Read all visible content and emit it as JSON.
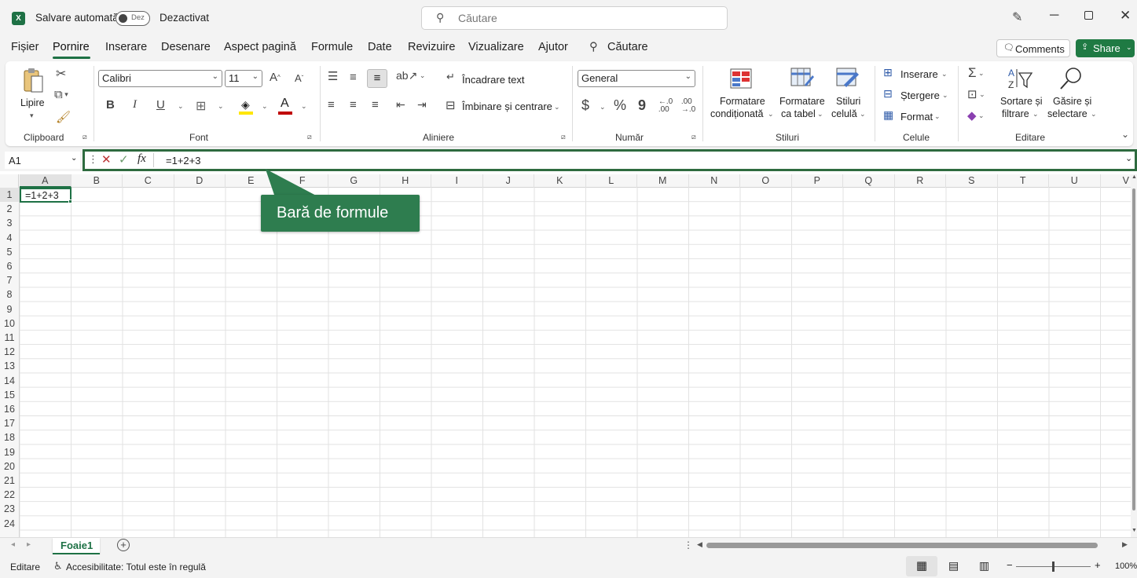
{
  "title_bar": {
    "autosave_label": "Salvare automată",
    "toggle_state": "Dez",
    "autosave_status": "Dezactivat",
    "search_placeholder": "Căutare"
  },
  "menu": {
    "items": [
      "Fișier",
      "Pornire",
      "Inserare",
      "Desenare",
      "Aspect pagină",
      "Formule",
      "Date",
      "Revizuire",
      "Vizualizare",
      "Ajutor"
    ],
    "active": "Pornire",
    "search_label": "Căutare",
    "comments_label": "Comments",
    "share_label": "Share"
  },
  "ribbon": {
    "clipboard": {
      "paste_label": "Lipire",
      "group_label": "Clipboard"
    },
    "font": {
      "font_name": "Calibri",
      "font_size": "11",
      "bold": "B",
      "italic": "I",
      "underline": "U",
      "group_label": "Font"
    },
    "alignment": {
      "wrap_text": "Încadrare text",
      "merge_center": "Îmbinare și centrare",
      "group_label": "Aliniere"
    },
    "number": {
      "format": "General",
      "currency": "$",
      "percent": "%",
      "comma": "9",
      "inc_decimal": "←.0\n.00",
      "dec_decimal": ".00\n→.0",
      "group_label": "Număr"
    },
    "styles": {
      "conditional_l1": "Formatare",
      "conditional_l2": "condiționată",
      "table_l1": "Formatare",
      "table_l2": "ca tabel",
      "cell_l1": "Stiluri",
      "cell_l2": "celulă",
      "group_label": "Stiluri"
    },
    "cells": {
      "insert": "Inserare",
      "delete": "Ștergere",
      "format": "Format",
      "group_label": "Celule"
    },
    "editing": {
      "sort_l1": "Sortare și",
      "sort_l2": "filtrare",
      "find_l1": "Găsire și",
      "find_l2": "selectare",
      "group_label": "Editare"
    }
  },
  "formula_bar": {
    "name_box": "A1",
    "fx": "fx",
    "formula": "=1+2+3"
  },
  "callout": {
    "text": "Bară de formule"
  },
  "columns": [
    "A",
    "B",
    "C",
    "D",
    "E",
    "F",
    "G",
    "H",
    "I",
    "J",
    "K",
    "L",
    "M",
    "N",
    "O",
    "P",
    "Q",
    "R",
    "S",
    "T",
    "U",
    "V"
  ],
  "rows": [
    "1",
    "2",
    "3",
    "4",
    "5",
    "6",
    "7",
    "8",
    "9",
    "10",
    "11",
    "12",
    "13",
    "14",
    "15",
    "16",
    "17",
    "18",
    "19",
    "20",
    "21",
    "22",
    "23",
    "24"
  ],
  "cells": {
    "A1": "=1+2+3"
  },
  "sheet_tabs": {
    "active": "Foaie1"
  },
  "status_bar": {
    "mode": "Editare",
    "accessibility": "Accesibilitate: Totul este în regulă",
    "zoom": "100%"
  },
  "colors": {
    "excel_green": "#1e7145",
    "share_green": "#1f7a43",
    "callout_green": "#2e7d4f",
    "accent_red": "#c00000"
  }
}
